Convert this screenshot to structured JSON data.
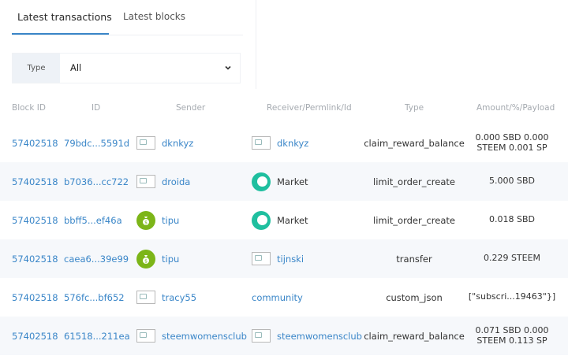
{
  "tabs": [
    {
      "label": "Latest transactions",
      "active": true
    },
    {
      "label": "Latest blocks",
      "active": false
    }
  ],
  "filter": {
    "label": "Type",
    "value": "All"
  },
  "columns": [
    "Block ID",
    "ID",
    "Sender",
    "Receiver/Permlink/Id",
    "Type",
    "Amount/%/Payload"
  ],
  "rows": [
    {
      "block": "57402518",
      "id": "79bdc...5591d",
      "sender": "dknkyz",
      "receiver": "dknkyz",
      "type": "claim_reward_balance",
      "amount": [
        "0.000 SBD 0.000",
        "STEEM 0.001 SP"
      ]
    },
    {
      "block": "57402518",
      "id": "b7036...cc722",
      "sender": "droida",
      "receiver": "Market",
      "type": "limit_order_create",
      "amount": [
        "5.000 SBD"
      ]
    },
    {
      "block": "57402518",
      "id": "bbff5...ef46a",
      "sender": "tipu",
      "receiver": "Market",
      "type": "limit_order_create",
      "amount": [
        "0.018 SBD"
      ]
    },
    {
      "block": "57402518",
      "id": "caea6...39e99",
      "sender": "tipu",
      "receiver": "tijnski",
      "type": "transfer",
      "amount": [
        "0.229 STEEM"
      ]
    },
    {
      "block": "57402518",
      "id": "576fc...bf652",
      "sender": "tracy55",
      "receiver": "community",
      "type": "custom_json",
      "amount": [
        "[\"subscri...19463\"}]"
      ]
    },
    {
      "block": "57402518",
      "id": "61518...211ea",
      "sender": "steemwomensclub",
      "receiver": "steemwomensclub",
      "type": "claim_reward_balance",
      "amount": [
        "0.071 SBD 0.000",
        "STEEM 0.113 SP"
      ]
    }
  ]
}
